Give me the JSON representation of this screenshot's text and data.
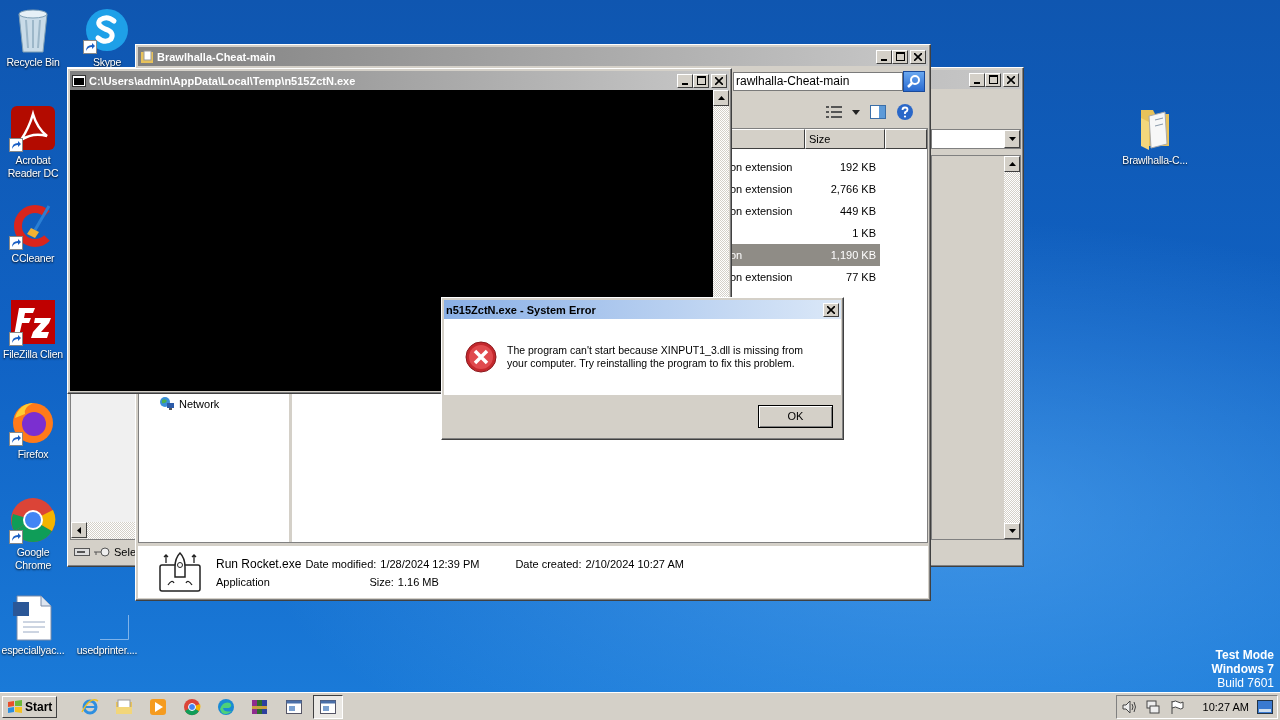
{
  "desktop_icons": [
    {
      "label": "Recycle Bin",
      "kind": "recycle",
      "shortcut": false
    },
    {
      "label": "Skype",
      "kind": "skype",
      "shortcut": true
    },
    {
      "label": "Acrobat Reader DC",
      "kind": "acrobat",
      "shortcut": true
    },
    {
      "label": "CCleaner",
      "kind": "ccleaner",
      "shortcut": true
    },
    {
      "label": "FileZilla Clien",
      "kind": "filezilla",
      "shortcut": true
    },
    {
      "label": "Firefox",
      "kind": "firefox",
      "shortcut": true
    },
    {
      "label": "Google Chrome",
      "kind": "chrome",
      "shortcut": true
    },
    {
      "label": "especiallyac...",
      "kind": "document",
      "shortcut": false
    },
    {
      "label": "usedprinter....",
      "kind": "blank",
      "shortcut": false
    },
    {
      "label": "Brawlhalla-C...",
      "kind": "folder",
      "shortcut": false
    }
  ],
  "back_window": {
    "status_text": "Sele"
  },
  "explorer": {
    "title": "Brawlhalla-Cheat-main",
    "address": "rawlhalla-Cheat-main",
    "columns": [
      "Size"
    ],
    "rows": [
      {
        "type": "on extension",
        "size": "192 KB",
        "selected": false
      },
      {
        "type": "on extension",
        "size": "2,766 KB",
        "selected": false
      },
      {
        "type": "on extension",
        "size": "449 KB",
        "selected": false
      },
      {
        "size": "1 KB",
        "selected": false
      },
      {
        "type": "on",
        "size": "1,190 KB",
        "selected": true
      },
      {
        "type": "on extension",
        "size": "77 KB",
        "selected": false
      }
    ],
    "nav_items": [
      "Network"
    ],
    "details": {
      "name": "Run Rocket.exe",
      "type": "Application",
      "date_modified_label": "Date modified:",
      "date_modified": "1/28/2024 12:39 PM",
      "size_label": "Size:",
      "size": "1.16 MB",
      "date_created_label": "Date created:",
      "date_created": "2/10/2024 10:27 AM"
    }
  },
  "console": {
    "title": "C:\\Users\\admin\\AppData\\Local\\Temp\\n515ZctN.exe"
  },
  "dialog": {
    "title": "n515ZctN.exe - System Error",
    "message": "The program can't start because XINPUT1_3.dll is missing from your computer. Try reinstalling the program to fix this problem.",
    "buttons": [
      "OK"
    ]
  },
  "taskbar": {
    "start": "Start",
    "apps": [
      {
        "kind": "ie",
        "selected": false
      },
      {
        "kind": "explorer",
        "selected": false
      },
      {
        "kind": "media",
        "selected": false
      },
      {
        "kind": "chrome",
        "selected": false
      },
      {
        "kind": "edge",
        "selected": false
      },
      {
        "kind": "winrar",
        "selected": false
      },
      {
        "kind": "window",
        "selected": false
      },
      {
        "kind": "window",
        "selected": true
      }
    ],
    "clock": "10:27 AM"
  },
  "os_notice": [
    {
      "text": "Test Mode",
      "bold": true
    },
    {
      "text": "Windows 7",
      "bold": true
    },
    {
      "text": "Build 7601",
      "bold": false
    }
  ]
}
